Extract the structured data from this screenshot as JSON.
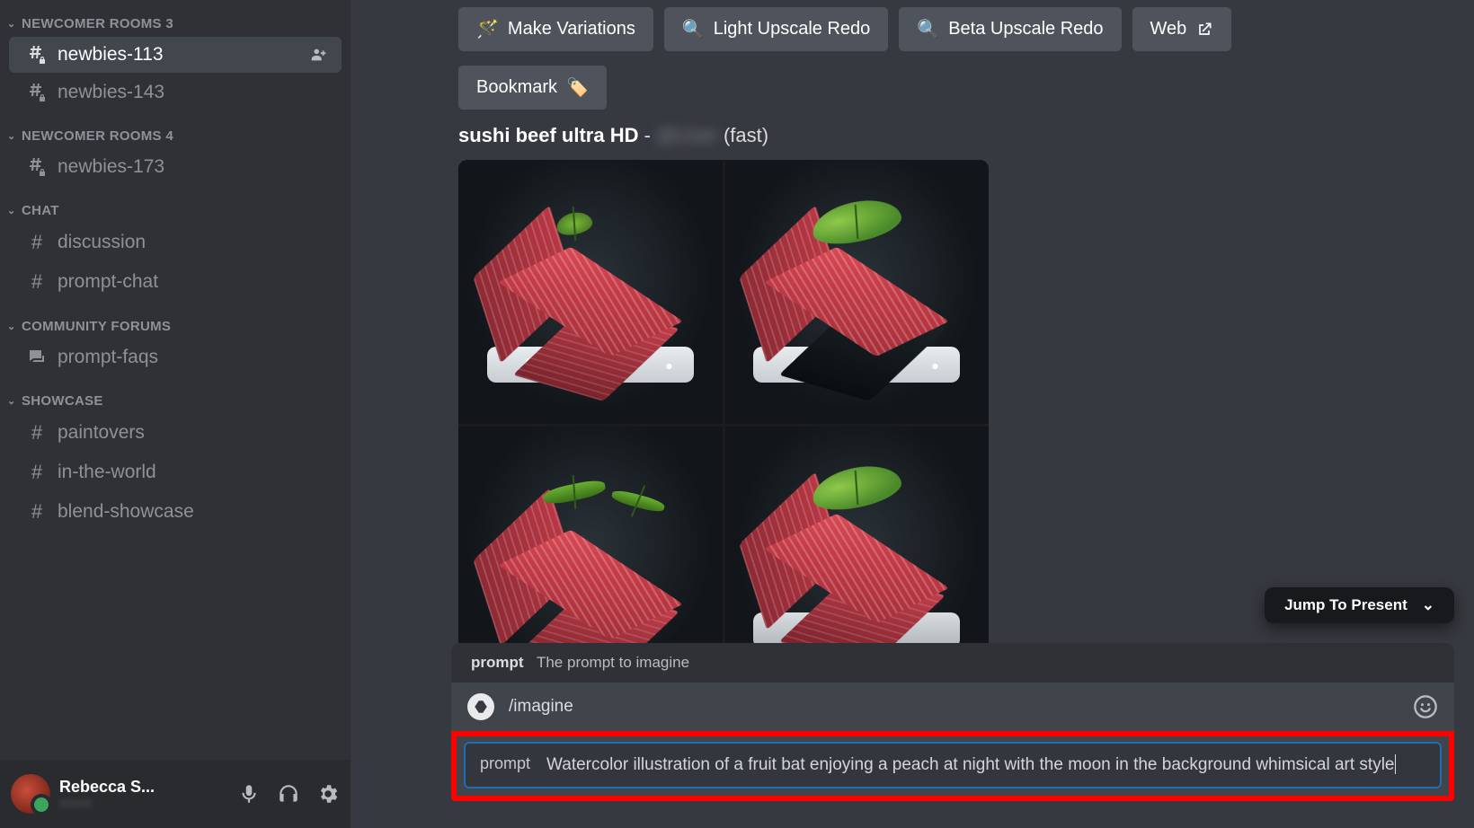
{
  "sidebar": {
    "categories": [
      {
        "name": "NEWCOMER ROOMS 3",
        "channels": [
          {
            "name": "newbies-113",
            "icon": "hash-lock",
            "active": true,
            "badge": "add-user"
          },
          {
            "name": "newbies-143",
            "icon": "hash-lock",
            "active": false
          }
        ]
      },
      {
        "name": "NEWCOMER ROOMS 4",
        "channels": [
          {
            "name": "newbies-173",
            "icon": "hash-lock",
            "active": false
          }
        ]
      },
      {
        "name": "CHAT",
        "channels": [
          {
            "name": "discussion",
            "icon": "hash",
            "active": false
          },
          {
            "name": "prompt-chat",
            "icon": "hash",
            "active": false
          }
        ]
      },
      {
        "name": "COMMUNITY FORUMS",
        "channels": [
          {
            "name": "prompt-faqs",
            "icon": "forum",
            "active": false
          }
        ]
      },
      {
        "name": "SHOWCASE",
        "channels": [
          {
            "name": "paintovers",
            "icon": "hash",
            "active": false
          },
          {
            "name": "in-the-world",
            "icon": "hash",
            "active": false
          },
          {
            "name": "blend-showcase",
            "icon": "hash",
            "active": false
          }
        ]
      }
    ]
  },
  "user": {
    "name": "Rebecca S...",
    "tag": "#0000"
  },
  "buttons": {
    "variations": "Make Variations",
    "light_upscale": "Light Upscale Redo",
    "beta_upscale": "Beta Upscale Redo",
    "web": "Web",
    "bookmark": "Bookmark"
  },
  "message": {
    "prompt_bold": "sushi beef ultra HD",
    "separator": " - ",
    "user_blur": "@User",
    "suffix": " (fast)"
  },
  "jump": "Jump To Present",
  "compose": {
    "hint_label": "prompt",
    "hint_desc": "The prompt to imagine",
    "command": "/imagine",
    "field_label": "prompt",
    "field_value": "Watercolor illustration of a fruit bat enjoying a peach at night with the moon in the background whimsical art style"
  }
}
